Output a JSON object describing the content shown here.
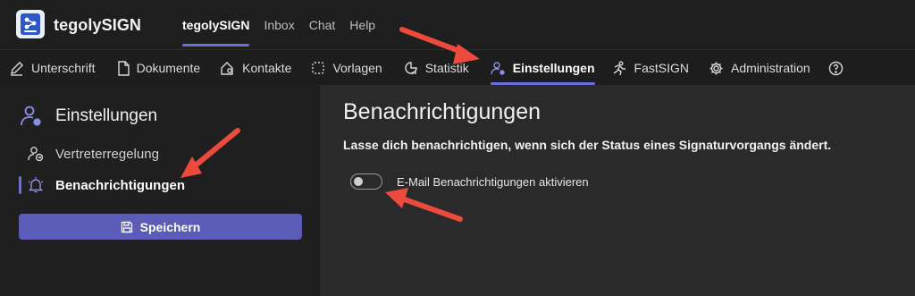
{
  "app": {
    "brand": "tegolySIGN"
  },
  "topnav": {
    "items": [
      {
        "label": "tegolySIGN",
        "active": true
      },
      {
        "label": "Inbox"
      },
      {
        "label": "Chat"
      },
      {
        "label": "Help"
      }
    ]
  },
  "subnav": {
    "items": [
      {
        "label": "Unterschrift",
        "icon": "pen-icon"
      },
      {
        "label": "Dokumente",
        "icon": "document-icon"
      },
      {
        "label": "Kontakte",
        "icon": "contacts-icon"
      },
      {
        "label": "Vorlagen",
        "icon": "template-icon"
      },
      {
        "label": "Statistik",
        "icon": "chart-icon"
      },
      {
        "label": "Einstellungen",
        "icon": "user-settings-icon",
        "active": true
      },
      {
        "label": "FastSIGN",
        "icon": "runner-icon"
      },
      {
        "label": "Administration",
        "icon": "gear-icon"
      },
      {
        "label": "",
        "icon": "help-icon"
      }
    ]
  },
  "sidebar": {
    "title": "Einstellungen",
    "items": [
      {
        "label": "Vertreterregelung",
        "icon": "user-substitute-icon"
      },
      {
        "label": "Benachrichtigungen",
        "icon": "bell-icon",
        "active": true
      }
    ],
    "save_label": "Speichern"
  },
  "main": {
    "title": "Benachrichtigungen",
    "description": "Lasse dich benachrichtigen, wenn sich der Status eines Signaturvorgangs ändert.",
    "toggle": {
      "label": "E-Mail Benachrichtigungen aktivieren",
      "enabled": false
    }
  },
  "colors": {
    "accent": "#6b6fd9",
    "button": "#5b5bb8",
    "arrow": "#ec4a3c"
  }
}
